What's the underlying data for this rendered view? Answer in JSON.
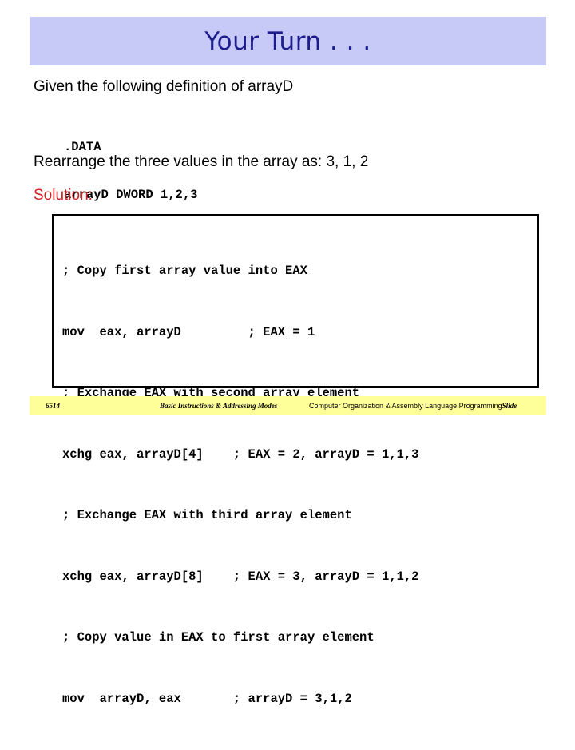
{
  "slide": {
    "title": "Your Turn . . .",
    "title_color": "#1c1c8c",
    "banner_color": "#c7c9f7",
    "background_color": "#ffffff"
  },
  "content": {
    "intro_line": "Given the following definition of arrayD",
    "definition": [
      ".DATA",
      "arrayD DWORD 1,2,3"
    ],
    "task_line": "Rearrange the three values in the array as: 3, 1, 2",
    "solution_label": "Solution:",
    "solution_label_color": "#cc2222",
    "code": [
      "; Copy first array value into EAX",
      "mov  eax, arrayD         ; EAX = 1",
      "; Exchange EAX with second array element",
      "xchg eax, arrayD[4]    ; EAX = 2, arrayD = 1,1,3",
      "; Exchange EAX with third array element",
      "xchg eax, arrayD[8]    ; EAX = 3, arrayD = 1,1,2",
      "; Copy value in EAX to first array element",
      "mov  arrayD, eax       ; arrayD = 3,1,2"
    ]
  },
  "footer": {
    "number": "6514",
    "center_text": "Basic Instructions & Addressing Modes",
    "right_text": "Computer Organization & Assembly Language Programming",
    "right_suffix": "Slide",
    "background_color": "#ffff99"
  }
}
